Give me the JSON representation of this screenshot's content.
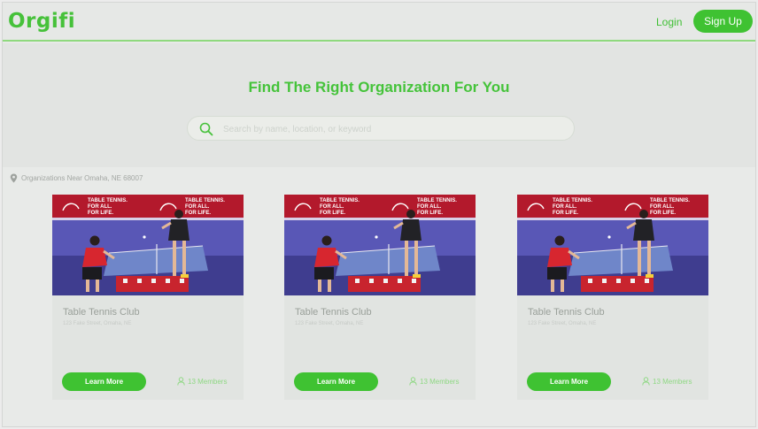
{
  "header": {
    "logo": "Orgifi",
    "login_label": "Login",
    "signup_label": "Sign Up"
  },
  "hero": {
    "title": "Find The Right Organization For You",
    "search_placeholder": "Search by name, location, or keyword"
  },
  "location": {
    "label": "Organizations Near Omaha, NE 68007"
  },
  "banner": {
    "line1": "TABLE TENNIS.",
    "line2": "FOR ALL.",
    "line3": "FOR LIFE."
  },
  "cards": [
    {
      "title": "Table Tennis Club",
      "address": "123 Fake Street, Omaha, NE",
      "button_label": "Learn More",
      "members": "13 Members"
    },
    {
      "title": "Table Tennis Club",
      "address": "123 Fake Street, Omaha, NE",
      "button_label": "Learn More",
      "members": "13 Members"
    },
    {
      "title": "Table Tennis Club",
      "address": "123 Fake Street, Omaha, NE",
      "button_label": "Learn More",
      "members": "13 Members"
    }
  ],
  "colors": {
    "brand_green": "#3fc232",
    "banner_red": "#b3192c",
    "table_blue": "#5b59b8"
  },
  "icons": {
    "search": "search-icon",
    "location": "map-pin-icon",
    "members": "user-icon"
  }
}
